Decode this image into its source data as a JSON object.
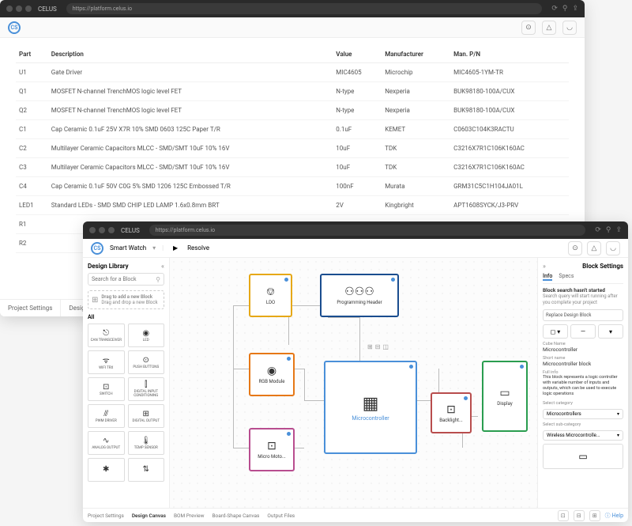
{
  "browser": {
    "brand": "CELUS",
    "url1": "https://platform.celus.io",
    "url2": "https://platform.celus.io"
  },
  "topbar_icons": [
    "history",
    "bell",
    "user"
  ],
  "window1": {
    "table_headers": {
      "part": "Part",
      "desc": "Description",
      "value": "Value",
      "mfr": "Manufacturer",
      "pn": "Man. P/N"
    },
    "rows": [
      {
        "part": "U1",
        "desc": "Gate Driver",
        "value": "MIC4605",
        "mfr": "Microchip",
        "pn": "MIC4605-1YM-TR"
      },
      {
        "part": "Q1",
        "desc": "MOSFET N-channel TrenchMOS logic level FET",
        "value": "N-type",
        "mfr": "Nexperia",
        "pn": "BUK98180-100A/CUX"
      },
      {
        "part": "Q2",
        "desc": "MOSFET N-channel TrenchMOS logic level FET",
        "value": "N-type",
        "mfr": "Nexperia",
        "pn": "BUK98180-100A/CUX"
      },
      {
        "part": "C1",
        "desc": "Cap Ceramic 0.1uF 25V X7R 10% SMD 0603 125C Paper T/R",
        "value": "0.1uF",
        "mfr": "KEMET",
        "pn": "C0603C104K3RACTU"
      },
      {
        "part": "C2",
        "desc": "Multilayer Ceramic Capacitors MLCC - SMD/SMT 10uF 10% 16V",
        "value": "10uF",
        "mfr": "TDK",
        "pn": "C3216X7R1C106K160AC"
      },
      {
        "part": "C3",
        "desc": "Multilayer Ceramic Capacitors MLCC - SMD/SMT 10uF 10% 16V",
        "value": "10uF",
        "mfr": "TDK",
        "pn": "C3216X7R1C106K160AC"
      },
      {
        "part": "C4",
        "desc": "Cap Ceramic 0.1uF 50V C0G 5% SMD 1206 125C Embossed T/R",
        "value": "100nF",
        "mfr": "Murata",
        "pn": "GRM31C5C1H104JA01L"
      },
      {
        "part": "LED1",
        "desc": "Standard LEDs - SMD SMD CHIP LED LAMP 1.6x0.8mm BRT",
        "value": "2V",
        "mfr": "Kingbright",
        "pn": "APT1608SYCK/J3-PRV"
      },
      {
        "part": "R1",
        "desc": "",
        "value": "",
        "mfr": "",
        "pn": ""
      },
      {
        "part": "R2",
        "desc": "",
        "value": "",
        "mfr": "",
        "pn": ""
      }
    ],
    "bottom_tabs": [
      "Project Settings",
      "Design Canvas"
    ]
  },
  "window2": {
    "project_name": "Smart Watch",
    "resolve_label": "Resolve",
    "left": {
      "title": "Design Library",
      "search_placeholder": "Search for a Block",
      "drag_hint_title": "Drag to add a new Block",
      "drag_hint_sub": "Drag and drop a new Block",
      "all_label": "All",
      "items": [
        {
          "icon": "⎋",
          "label": "CAN TRANSCEIVER"
        },
        {
          "icon": "◉",
          "label": "LED"
        },
        {
          "icon": "ᯤ",
          "label": "WIFI TRX"
        },
        {
          "icon": "⊙",
          "label": "PUSH BUTTONS"
        },
        {
          "icon": "⊡",
          "label": "SWITCH"
        },
        {
          "icon": "⫿",
          "label": "DIGITAL INPUT CONDITIONING"
        },
        {
          "icon": "⫻",
          "label": "PWM DRIVER"
        },
        {
          "icon": "⊞",
          "label": "DIGITAL OUTPUT"
        },
        {
          "icon": "∿",
          "label": "ANALOG OUTPUT"
        },
        {
          "icon": "🌡",
          "label": "TEMP SENSOR"
        },
        {
          "icon": "✱",
          "label": ""
        },
        {
          "icon": "⇅",
          "label": ""
        }
      ]
    },
    "blocks": {
      "ldo": "LDO",
      "prog_header": "Programming Header",
      "rgb": "RGB Module",
      "micro_moto": "Micro Moto...",
      "mcu": "Microcontroller",
      "backlight": "Backlight...",
      "display": "Display"
    },
    "right": {
      "title": "Block Settings",
      "tab_info": "Info",
      "tab_specs": "Specs",
      "msg_title": "Block search hasn't started",
      "msg_body": "Search query will start running after you complete your project",
      "replace_btn": "Replace Design Block",
      "field_name_label": "Cube Name",
      "field_name_val": "Microcontroller",
      "field_short_label": "Short name",
      "field_short_val": "Microcontroller block",
      "field_desc_label": "Full info",
      "field_desc_val": "This block represents a logic controller with variable number of inputs and outputs, which can be used to execute logic operations",
      "cat_label": "Select category",
      "cat_val": "Microcontrollers",
      "subcat_label": "Select sub-category",
      "subcat_val": "Wireless Microcontrolle..."
    },
    "bottom_tabs": [
      "Project Settings",
      "Design Canvas",
      "BOM Preview",
      "Board-Shape Canvas",
      "Output Files"
    ],
    "help_label": "Help"
  }
}
